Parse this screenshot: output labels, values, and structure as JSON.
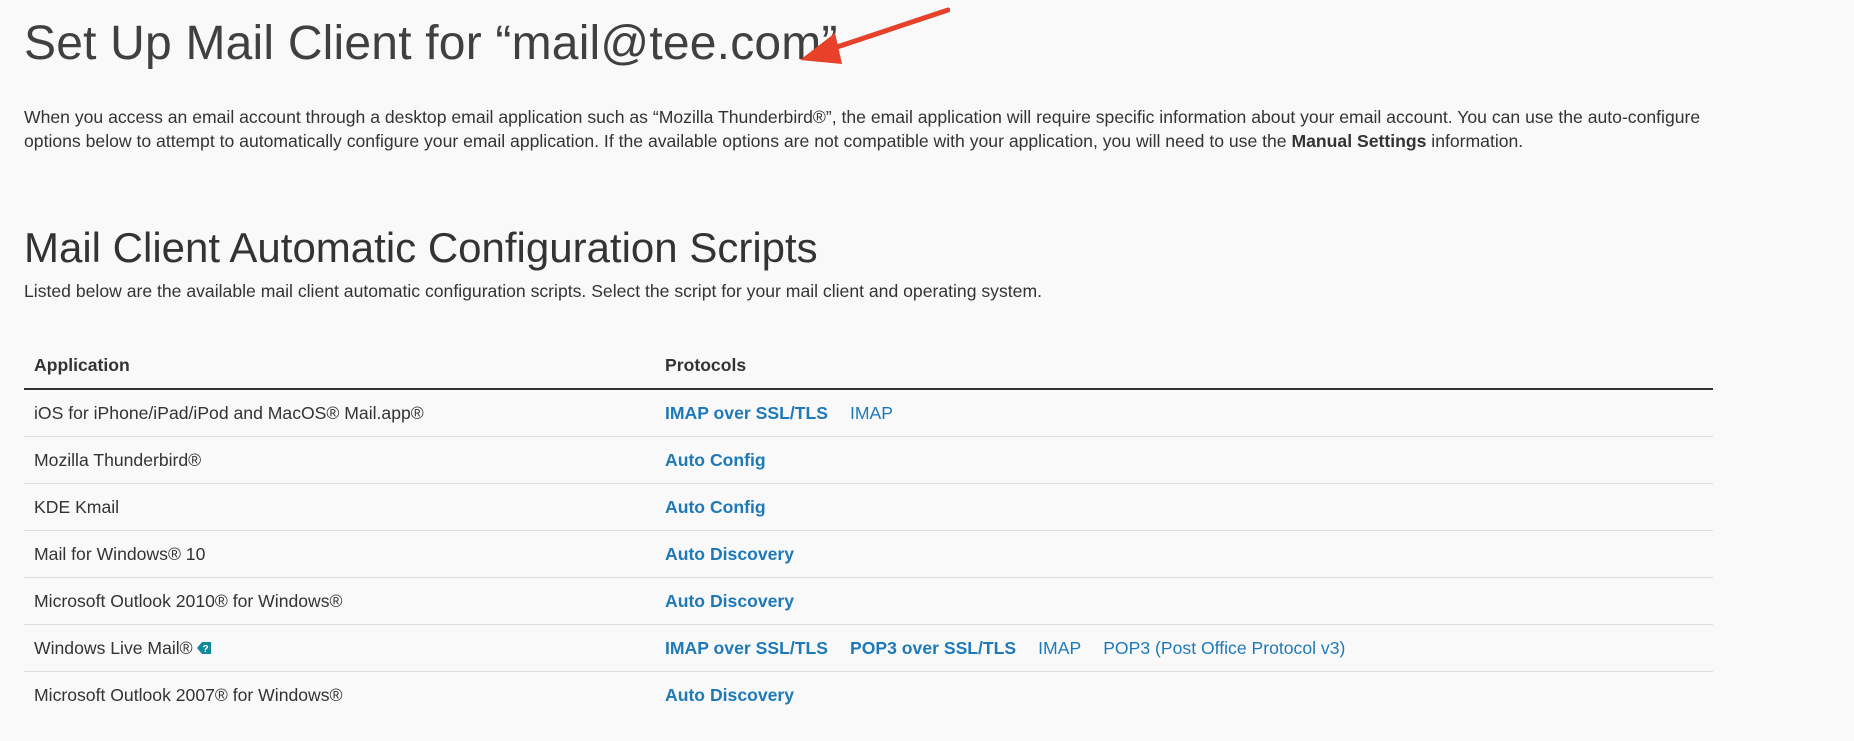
{
  "header": {
    "title": "Set Up Mail Client for “mail@tee.com”"
  },
  "intro": {
    "text_before_bold": "When you access an email account through a desktop email application such as “Mozilla Thunderbird®”, the email application will require specific information about your email account. You can use the auto-configure options below to attempt to automatically configure your email application. If the available options are not compatible with your application, you will need to use the ",
    "bold": "Manual Settings",
    "text_after_bold": " information."
  },
  "section": {
    "title": "Mail Client Automatic Configuration Scripts",
    "description": "Listed below are the available mail client automatic configuration scripts. Select the script for your mail client and operating system."
  },
  "table": {
    "columns": [
      "Application",
      "Protocols"
    ],
    "rows": [
      {
        "application": "iOS for iPhone/iPad/iPod and MacOS® Mail.app®",
        "protocols": [
          {
            "label": "IMAP over SSL/TLS",
            "bold": true
          },
          {
            "label": "IMAP",
            "bold": false
          }
        ]
      },
      {
        "application": "Mozilla Thunderbird®",
        "protocols": [
          {
            "label": "Auto Config",
            "bold": true
          }
        ]
      },
      {
        "application": "KDE Kmail",
        "protocols": [
          {
            "label": "Auto Config",
            "bold": true
          }
        ]
      },
      {
        "application": "Mail for Windows® 10",
        "protocols": [
          {
            "label": "Auto Discovery",
            "bold": true
          }
        ]
      },
      {
        "application": "Microsoft Outlook 2010® for Windows®",
        "protocols": [
          {
            "label": "Auto Discovery",
            "bold": true
          }
        ]
      },
      {
        "application": "Windows Live Mail®",
        "help_icon": "help-icon",
        "protocols": [
          {
            "label": "IMAP over SSL/TLS",
            "bold": true
          },
          {
            "label": "POP3 over SSL/TLS",
            "bold": true
          },
          {
            "label": "IMAP",
            "bold": false
          },
          {
            "label": "POP3 (Post Office Protocol v3)",
            "bold": false
          }
        ]
      },
      {
        "application": "Microsoft Outlook 2007® for Windows®",
        "protocols": [
          {
            "label": "Auto Discovery",
            "bold": true
          }
        ]
      }
    ]
  },
  "colors": {
    "background": "#f9f9f9",
    "text": "#333333",
    "link": "#1e79b8",
    "annotation_arrow": "#e8412a",
    "help_icon": "#138a9b"
  }
}
